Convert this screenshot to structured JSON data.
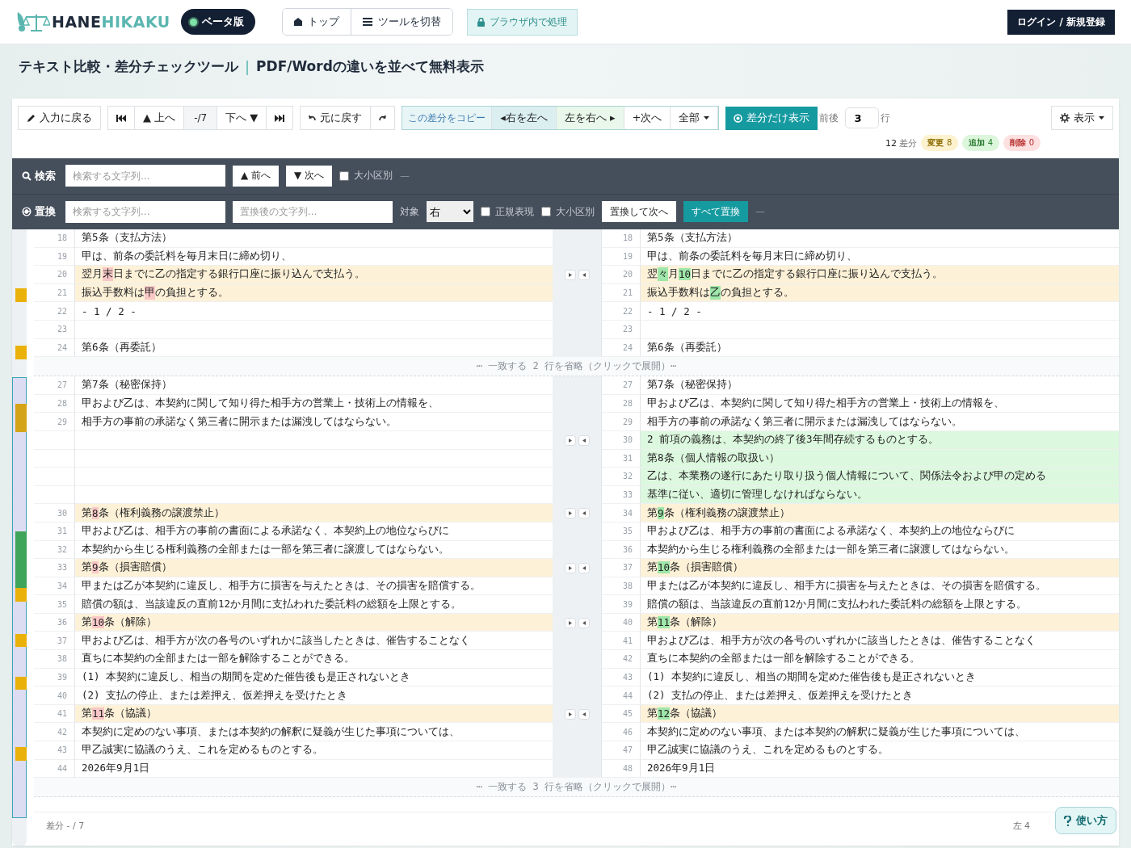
{
  "header": {
    "logo_primary": "HANE",
    "logo_secondary": "HIKAKU",
    "badge": "ベータ版",
    "nav": [
      {
        "label": "トップ"
      },
      {
        "label": "ツールを切替"
      }
    ],
    "privacy": "ブラウザ内で処理",
    "login": "ログイン / 新規登録"
  },
  "page_title": {
    "main": "テキスト比較・差分チェックツール",
    "separator": "|",
    "sub": "PDF/Wordの違いを並べて無料表示"
  },
  "toolbar": {
    "back": "入力に戻る",
    "nav": {
      "up": "▲ 上へ",
      "position": "-/7",
      "down": "下へ ▼"
    },
    "undo": "元に戻す",
    "merge": {
      "copy": "この差分をコピー",
      "right_to_left": "◂右を左へ",
      "left_to_right": "左を右へ ▸",
      "next": "+次へ",
      "all": "全部"
    },
    "diff_only": {
      "label": "差分だけ表示",
      "on": true
    },
    "context": {
      "label": "前後",
      "value": "3",
      "unit": "行"
    },
    "view": "表示",
    "summary": {
      "total": "12",
      "total_label": "差分",
      "badges": [
        {
          "kind": "change",
          "label": "変更",
          "count": "8"
        },
        {
          "kind": "add",
          "label": "追加",
          "count": "4"
        },
        {
          "kind": "delete",
          "label": "削除",
          "count": "0"
        }
      ]
    }
  },
  "search": {
    "label": "検索",
    "placeholder": "検索する文字列...",
    "prev": "▲ 前へ",
    "next": "▼ 次へ",
    "case": {
      "label": "大小区別",
      "checked": false
    },
    "result": "—"
  },
  "replace": {
    "label": "置換",
    "find_placeholder": "検索する文字列...",
    "replace_placeholder": "置換後の文字列...",
    "target_label": "対象",
    "target": "右",
    "regex": {
      "label": "正規表現",
      "checked": false
    },
    "case": {
      "label": "大小区別",
      "checked": false
    },
    "replace_next": "置換して次へ",
    "replace_all": "すべて置換",
    "result": "—"
  },
  "rows": [
    {
      "kind": "same",
      "left": {
        "num": "18",
        "text": "第5条（支払方法）"
      },
      "right": {
        "num": "18",
        "text": "第5条（支払方法）"
      }
    },
    {
      "kind": "same",
      "left": {
        "num": "19",
        "text": "甲は、前条の委託料を毎月末日に締め切り、"
      },
      "right": {
        "num": "19",
        "text": "甲は、前条の委託料を毎月末日に締め切り、"
      }
    },
    {
      "kind": "change",
      "left": {
        "num": "20",
        "segments": [
          {
            "text": "翌月"
          },
          {
            "text": "末",
            "changed": true
          },
          {
            "text": "日までに乙の指定する銀行口座に振り込んで支払う。"
          }
        ]
      },
      "right": {
        "num": "20",
        "segments": [
          {
            "text": "翌"
          },
          {
            "text": "々",
            "changed": true
          },
          {
            "text": "月"
          },
          {
            "text": "10",
            "changed": true
          },
          {
            "text": "日までに乙の指定する銀行口座に振り込んで支払う。"
          }
        ]
      }
    },
    {
      "kind": "change",
      "left": {
        "num": "21",
        "segments": [
          {
            "text": "振込手数料は"
          },
          {
            "text": "甲",
            "changed": true
          },
          {
            "text": "の負担とする。"
          }
        ]
      },
      "right": {
        "num": "21",
        "segments": [
          {
            "text": "振込手数料は"
          },
          {
            "text": "乙",
            "changed": true
          },
          {
            "text": "の負担とする。"
          }
        ]
      }
    },
    {
      "kind": "same",
      "left": {
        "num": "22",
        "text": "- 1 / 2 -"
      },
      "right": {
        "num": "22",
        "text": "- 1 / 2 -"
      }
    },
    {
      "kind": "same",
      "left": {
        "num": "23"
      },
      "right": {
        "num": "23"
      }
    },
    {
      "kind": "same",
      "left": {
        "num": "24",
        "text": "第6条（再委託）"
      },
      "right": {
        "num": "24",
        "text": "第6条（再委託）"
      }
    },
    {
      "kind": "gap",
      "text": "⋯ 一致する 2 行を省略（クリックで展開）⋯"
    },
    {
      "kind": "same",
      "left": {
        "num": "27",
        "text": "第7条（秘密保持）"
      },
      "right": {
        "num": "27",
        "text": "第7条（秘密保持）"
      }
    },
    {
      "kind": "same",
      "left": {
        "num": "28",
        "text": "甲および乙は、本契約に関して知り得た相手方の営業上・技術上の情報を、"
      },
      "right": {
        "num": "28",
        "text": "甲および乙は、本契約に関して知り得た相手方の営業上・技術上の情報を、"
      }
    },
    {
      "kind": "same",
      "left": {
        "num": "29",
        "text": "相手方の事前の承諾なく第三者に開示または漏洩してはならない。"
      },
      "right": {
        "num": "29",
        "text": "相手方の事前の承諾なく第三者に開示または漏洩してはならない。"
      }
    },
    {
      "kind": "add",
      "right": {
        "num": "30",
        "text": "2 前項の義務は、本契約の終了後3年間存続するものとする。"
      }
    },
    {
      "kind": "add",
      "right": {
        "num": "31",
        "text": "第8条（個人情報の取扱い）"
      }
    },
    {
      "kind": "add",
      "right": {
        "num": "32",
        "text": "乙は、本業務の遂行にあたり取り扱う個人情報について、関係法令および甲の定める"
      }
    },
    {
      "kind": "add",
      "right": {
        "num": "33",
        "text": "基準に従い、適切に管理しなければならない。"
      }
    },
    {
      "kind": "change",
      "left": {
        "num": "30",
        "segments": [
          {
            "text": "第"
          },
          {
            "text": "8",
            "changed": true
          },
          {
            "text": "条（権利義務の譲渡禁止）"
          }
        ]
      },
      "right": {
        "num": "34",
        "segments": [
          {
            "text": "第"
          },
          {
            "text": "9",
            "changed": true
          },
          {
            "text": "条（権利義務の譲渡禁止）"
          }
        ]
      }
    },
    {
      "kind": "same",
      "left": {
        "num": "31",
        "text": "甲および乙は、相手方の事前の書面による承諾なく、本契約上の地位ならびに"
      },
      "right": {
        "num": "35",
        "text": "甲および乙は、相手方の事前の書面による承諾なく、本契約上の地位ならびに"
      }
    },
    {
      "kind": "same",
      "left": {
        "num": "32",
        "text": "本契約から生じる権利義務の全部または一部を第三者に譲渡してはならない。"
      },
      "right": {
        "num": "36",
        "text": "本契約から生じる権利義務の全部または一部を第三者に譲渡してはならない。"
      }
    },
    {
      "kind": "change",
      "left": {
        "num": "33",
        "segments": [
          {
            "text": "第"
          },
          {
            "text": "9",
            "changed": true
          },
          {
            "text": "条（損害賠償）"
          }
        ]
      },
      "right": {
        "num": "37",
        "segments": [
          {
            "text": "第"
          },
          {
            "text": "10",
            "changed": true
          },
          {
            "text": "条（損害賠償）"
          }
        ]
      }
    },
    {
      "kind": "same",
      "left": {
        "num": "34",
        "text": "甲または乙が本契約に違反し、相手方に損害を与えたときは、その損害を賠償する。"
      },
      "right": {
        "num": "38",
        "text": "甲または乙が本契約に違反し、相手方に損害を与えたときは、その損害を賠償する。"
      }
    },
    {
      "kind": "same",
      "left": {
        "num": "35",
        "text": "賠償の額は、当該違反の直前12か月間に支払われた委託料の総額を上限とする。"
      },
      "right": {
        "num": "39",
        "text": "賠償の額は、当該違反の直前12か月間に支払われた委託料の総額を上限とする。"
      }
    },
    {
      "kind": "change",
      "left": {
        "num": "36",
        "segments": [
          {
            "text": "第"
          },
          {
            "text": "10",
            "changed": true
          },
          {
            "text": "条（解除）"
          }
        ]
      },
      "right": {
        "num": "40",
        "segments": [
          {
            "text": "第"
          },
          {
            "text": "11",
            "changed": true
          },
          {
            "text": "条（解除）"
          }
        ]
      }
    },
    {
      "kind": "same",
      "left": {
        "num": "37",
        "text": "甲および乙は、相手方が次の各号のいずれかに該当したときは、催告することなく"
      },
      "right": {
        "num": "41",
        "text": "甲および乙は、相手方が次の各号のいずれかに該当したときは、催告することなく"
      }
    },
    {
      "kind": "same",
      "left": {
        "num": "38",
        "text": "直ちに本契約の全部または一部を解除することができる。"
      },
      "right": {
        "num": "42",
        "text": "直ちに本契約の全部または一部を解除することができる。"
      }
    },
    {
      "kind": "same",
      "left": {
        "num": "39",
        "text": "(1) 本契約に違反し、相当の期間を定めた催告後も是正されないとき"
      },
      "right": {
        "num": "43",
        "text": "(1) 本契約に違反し、相当の期間を定めた催告後も是正されないとき"
      }
    },
    {
      "kind": "same",
      "left": {
        "num": "40",
        "text": "(2) 支払の停止、または差押え、仮差押えを受けたとき"
      },
      "right": {
        "num": "44",
        "text": "(2) 支払の停止、または差押え、仮差押えを受けたとき"
      }
    },
    {
      "kind": "change",
      "left": {
        "num": "41",
        "segments": [
          {
            "text": "第"
          },
          {
            "text": "11",
            "changed": true
          },
          {
            "text": "条（協議）"
          }
        ]
      },
      "right": {
        "num": "45",
        "segments": [
          {
            "text": "第"
          },
          {
            "text": "12",
            "changed": true
          },
          {
            "text": "条（協議）"
          }
        ]
      }
    },
    {
      "kind": "same",
      "left": {
        "num": "42",
        "text": "本契約に定めのない事項、または本契約の解釈に疑義が生じた事項については、"
      },
      "right": {
        "num": "46",
        "text": "本契約に定めのない事項、または本契約の解釈に疑義が生じた事項については、"
      }
    },
    {
      "kind": "same",
      "left": {
        "num": "43",
        "text": "甲乙誠実に協議のうえ、これを定めるものとする。"
      },
      "right": {
        "num": "47",
        "text": "甲乙誠実に協議のうえ、これを定めるものとする。"
      }
    },
    {
      "kind": "same",
      "left": {
        "num": "44",
        "text": "2026年9月1日"
      },
      "right": {
        "num": "48",
        "text": "2026年9月1日"
      }
    },
    {
      "kind": "gap",
      "text": "⋯ 一致する 3 行を省略（クリックで展開）⋯"
    }
  ],
  "footer": {
    "position": "差分 - / 7",
    "lines": "左 4"
  },
  "help": "使い方"
}
